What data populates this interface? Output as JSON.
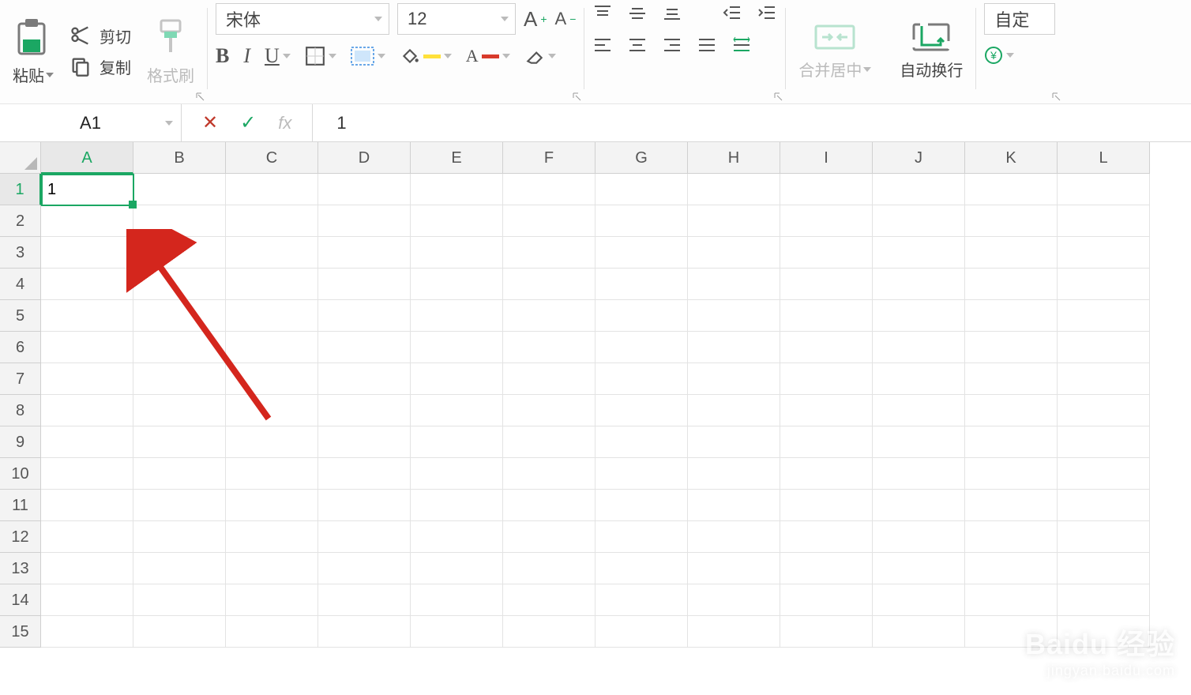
{
  "ribbon": {
    "clipboard": {
      "paste": "粘贴",
      "cut": "剪切",
      "copy": "复制",
      "format_painter": "格式刷"
    },
    "font": {
      "name": "宋体",
      "size": "12",
      "increase_font_label": "A+",
      "decrease_font_label": "A-"
    },
    "align": {
      "merge_center": "合并居中",
      "wrap_text": "自动换行"
    },
    "number": {
      "custom": "自定"
    }
  },
  "name_box": "A1",
  "formula_bar_value": "1",
  "active_cell_value": "1",
  "columns": [
    "A",
    "B",
    "C",
    "D",
    "E",
    "F",
    "G",
    "H",
    "I",
    "J",
    "K",
    "L"
  ],
  "rows": [
    "1",
    "2",
    "3",
    "4",
    "5",
    "6",
    "7",
    "8",
    "9",
    "10",
    "11",
    "12",
    "13",
    "14",
    "15"
  ],
  "active_col_index": 0,
  "active_row_index": 0,
  "watermark_main": "Baidu 经验",
  "watermark_sub": "jingyan.baidu.com"
}
